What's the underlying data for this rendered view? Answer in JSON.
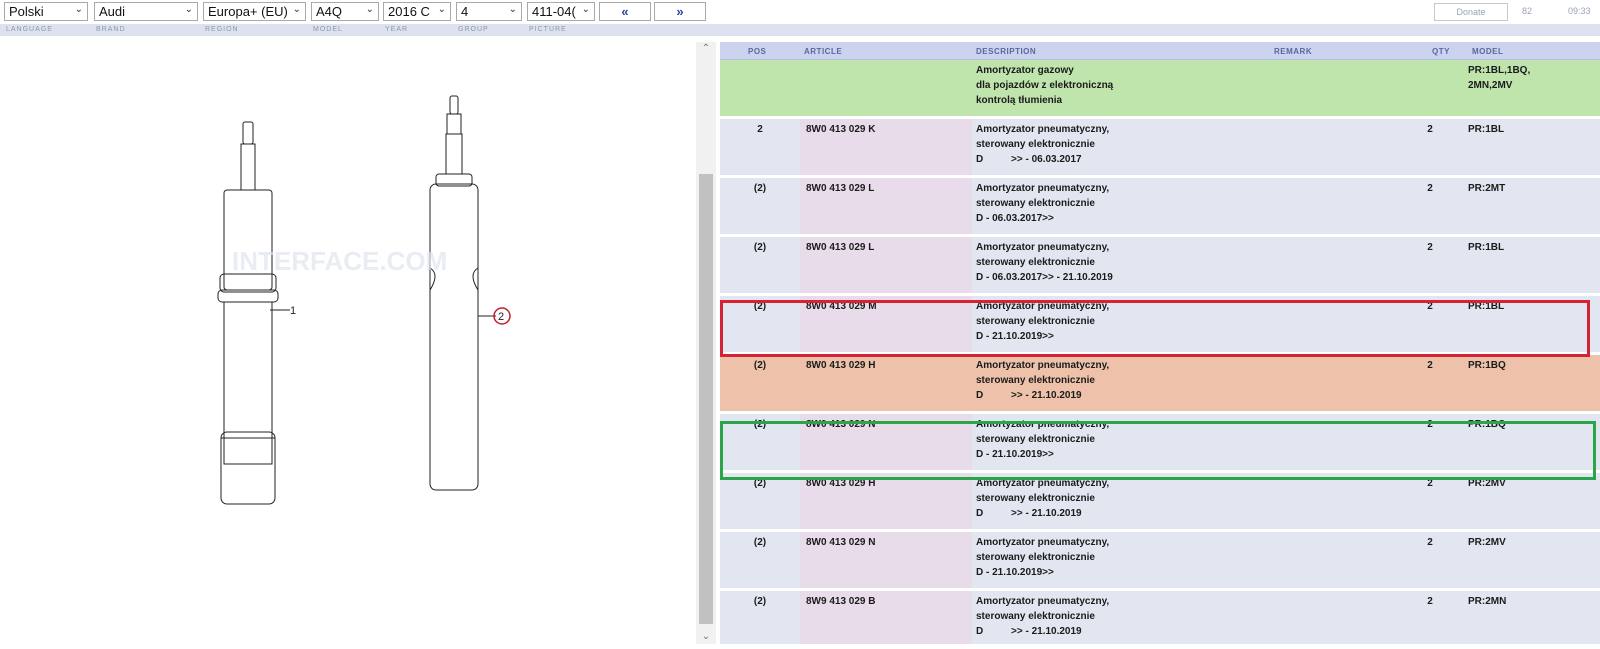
{
  "toolbar": {
    "language": "Polski",
    "brand": "Audi",
    "region": "Europa+ (EU)",
    "model": "A4Q",
    "year": "2016 C",
    "group": "4",
    "picture": "411-04(",
    "prev_label": "«",
    "next_label": "»",
    "donate_label": "Donate",
    "count": "82",
    "time": "09:33"
  },
  "labels": {
    "language": "LANGUAGE",
    "brand": "BRAND",
    "region": "REGION",
    "model": "MODEL",
    "year": "YEAR",
    "group": "GROUP",
    "picture": "PICTURE"
  },
  "diagram": {
    "callout_1": "1",
    "callout_2": "2",
    "watermark": "INTERFACE.COM"
  },
  "table": {
    "headers": {
      "pos": "POS",
      "article": "ARTICLE",
      "description": "DESCRIPTION",
      "remark": "REMARK",
      "qty": "QTY",
      "model": "MODEL"
    },
    "rows": [
      {
        "pos": "",
        "article": "",
        "desc1": "Amortyzator gazowy",
        "desc2": "dla pojazdów z elektroniczną",
        "desc3": "kontrolą tłumienia",
        "qty": "",
        "model1": "PR:1BL,1BQ,",
        "model2": "2MN,2MV",
        "style": "green"
      },
      {
        "pos": "2",
        "article": "8W0 413 029 K",
        "desc1": "Amortyzator pneumatyczny,",
        "desc2": "sterowany elektronicznie",
        "desc3": "D          >> - 06.03.2017",
        "qty": "2",
        "model1": "PR:1BL",
        "model2": "",
        "style": "normal"
      },
      {
        "pos": "(2)",
        "article": "8W0 413 029 L",
        "desc1": "Amortyzator pneumatyczny,",
        "desc2": "sterowany elektronicznie",
        "desc3": "D - 06.03.2017>>",
        "qty": "2",
        "model1": "PR:2MT",
        "model2": "",
        "style": "normal"
      },
      {
        "pos": "(2)",
        "article": "8W0 413 029 L",
        "desc1": "Amortyzator pneumatyczny,",
        "desc2": "sterowany elektronicznie",
        "desc3": "D - 06.03.2017>> - 21.10.2019",
        "qty": "2",
        "model1": "PR:1BL",
        "model2": "",
        "style": "normal"
      },
      {
        "pos": "(2)",
        "article": "8W0 413 029 M",
        "desc1": "Amortyzator pneumatyczny,",
        "desc2": "sterowany elektronicznie",
        "desc3": "D - 21.10.2019>>",
        "qty": "2",
        "model1": "PR:1BL",
        "model2": "",
        "style": "normal"
      },
      {
        "pos": "(2)",
        "article": "8W0 413 029 H",
        "desc1": "Amortyzator pneumatyczny,",
        "desc2": "sterowany elektronicznie",
        "desc3": "D          >> - 21.10.2019",
        "qty": "2",
        "model1": "PR:1BQ",
        "model2": "",
        "style": "orange"
      },
      {
        "pos": "(2)",
        "article": "8W0 413 029 N",
        "desc1": "Amortyzator pneumatyczny,",
        "desc2": "sterowany elektronicznie",
        "desc3": "D - 21.10.2019>>",
        "qty": "2",
        "model1": "PR:1BQ",
        "model2": "",
        "style": "normal"
      },
      {
        "pos": "(2)",
        "article": "8W0 413 029 H",
        "desc1": "Amortyzator pneumatyczny,",
        "desc2": "sterowany elektronicznie",
        "desc3": "D          >> - 21.10.2019",
        "qty": "2",
        "model1": "PR:2MV",
        "model2": "",
        "style": "normal"
      },
      {
        "pos": "(2)",
        "article": "8W0 413 029 N",
        "desc1": "Amortyzator pneumatyczny,",
        "desc2": "sterowany elektronicznie",
        "desc3": "D - 21.10.2019>>",
        "qty": "2",
        "model1": "PR:2MV",
        "model2": "",
        "style": "normal"
      },
      {
        "pos": "(2)",
        "article": "8W9 413 029 B",
        "desc1": "Amortyzator pneumatyczny,",
        "desc2": "sterowany elektronicznie",
        "desc3": "D          >> - 21.10.2019",
        "qty": "2",
        "model1": "PR:2MN",
        "model2": "",
        "style": "normal"
      }
    ]
  },
  "colors": {
    "row_normal": "#e2e6f0",
    "article_bg": "#e8dcea",
    "row_green": "#bfe5ad",
    "row_orange": "#eec2aa",
    "highlight_red": "#d62333",
    "highlight_green": "#2aa54a"
  }
}
